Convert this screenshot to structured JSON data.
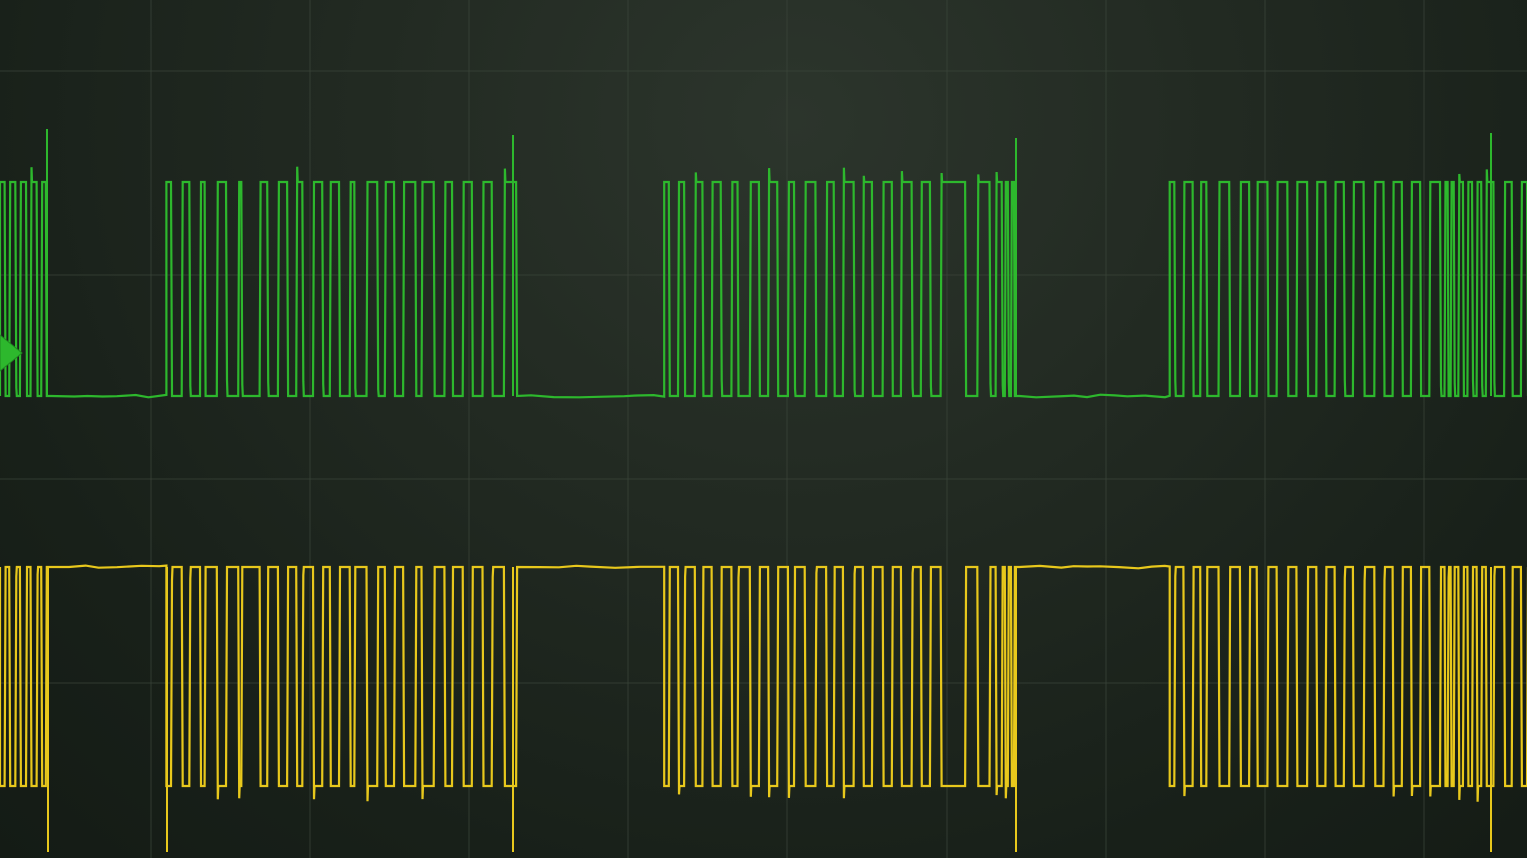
{
  "display": {
    "background": "#1e261e",
    "grid_color": "#3a4439",
    "grid": true,
    "horizontal_divisions": 10,
    "vertical_divisions": 4
  },
  "channels": [
    {
      "name": "",
      "color": "#2db82d",
      "level_marker_icon": "trigger-level-arrow-icon",
      "idle_level": "low",
      "packets": [
        {
          "start": 0.0,
          "end": 0.033,
          "transitions": [
            0.003,
            0.006,
            0.01,
            0.013,
            0.017,
            0.02,
            0.024,
            0.027,
            0.03
          ]
        },
        {
          "start": 0.109,
          "end": 0.338,
          "transitions": [
            0.112,
            0.119,
            0.124,
            0.131,
            0.134,
            0.142,
            0.148,
            0.156,
            0.158,
            0.17,
            0.175,
            0.182,
            0.188,
            0.194,
            0.198,
            0.205,
            0.211,
            0.216,
            0.222,
            0.229,
            0.232,
            0.24,
            0.247,
            0.252,
            0.258,
            0.264,
            0.272,
            0.276,
            0.284,
            0.291,
            0.296,
            0.303,
            0.309,
            0.316,
            0.322,
            0.33
          ]
        },
        {
          "start": 0.435,
          "end": 0.667,
          "transitions": [
            0.438,
            0.444,
            0.448,
            0.455,
            0.46,
            0.466,
            0.472,
            0.479,
            0.483,
            0.491,
            0.497,
            0.503,
            0.509,
            0.516,
            0.52,
            0.527,
            0.534,
            0.541,
            0.546,
            0.552,
            0.559,
            0.565,
            0.571,
            0.578,
            0.584,
            0.59,
            0.597,
            0.603,
            0.609,
            0.616,
            0.632,
            0.64,
            0.648,
            0.652,
            0.656,
            0.658,
            0.66,
            0.662,
            0.664
          ]
        },
        {
          "start": 0.766,
          "end": 1.0,
          "transitions": [
            0.769,
            0.775,
            0.781,
            0.786,
            0.79,
            0.798,
            0.805,
            0.812,
            0.818,
            0.823,
            0.83,
            0.836,
            0.843,
            0.849,
            0.856,
            0.862,
            0.868,
            0.874,
            0.88,
            0.886,
            0.893,
            0.9,
            0.906,
            0.912,
            0.918,
            0.924,
            0.93,
            0.936,
            0.943,
            0.946,
            0.948,
            0.95,
            0.952,
            0.955,
            0.958,
            0.961,
            0.964,
            0.967,
            0.97,
            0.973,
            0.978,
            0.985,
            0.99,
            0.996
          ]
        }
      ]
    },
    {
      "name": "",
      "color": "#e8c81c",
      "level_marker_icon": "",
      "idle_level": "high",
      "packets": [
        {
          "start": 0.0,
          "end": 0.033,
          "transitions": [
            0.003,
            0.006,
            0.01,
            0.013,
            0.017,
            0.02,
            0.024,
            0.027,
            0.03
          ]
        },
        {
          "start": 0.109,
          "end": 0.338,
          "transitions": [
            0.112,
            0.119,
            0.124,
            0.131,
            0.134,
            0.142,
            0.148,
            0.156,
            0.158,
            0.17,
            0.175,
            0.182,
            0.188,
            0.194,
            0.198,
            0.205,
            0.211,
            0.216,
            0.222,
            0.229,
            0.232,
            0.24,
            0.247,
            0.252,
            0.258,
            0.264,
            0.272,
            0.276,
            0.284,
            0.291,
            0.296,
            0.303,
            0.309,
            0.316,
            0.322,
            0.33
          ]
        },
        {
          "start": 0.435,
          "end": 0.667,
          "transitions": [
            0.438,
            0.444,
            0.448,
            0.455,
            0.46,
            0.466,
            0.472,
            0.479,
            0.483,
            0.491,
            0.497,
            0.503,
            0.509,
            0.516,
            0.52,
            0.527,
            0.534,
            0.541,
            0.546,
            0.552,
            0.559,
            0.565,
            0.571,
            0.578,
            0.584,
            0.59,
            0.597,
            0.603,
            0.609,
            0.616,
            0.632,
            0.64,
            0.648,
            0.652,
            0.656,
            0.658,
            0.66,
            0.662,
            0.664
          ]
        },
        {
          "start": 0.766,
          "end": 1.0,
          "transitions": [
            0.769,
            0.775,
            0.781,
            0.786,
            0.79,
            0.798,
            0.805,
            0.812,
            0.818,
            0.823,
            0.83,
            0.836,
            0.843,
            0.849,
            0.856,
            0.862,
            0.868,
            0.874,
            0.88,
            0.886,
            0.893,
            0.9,
            0.906,
            0.912,
            0.918,
            0.924,
            0.93,
            0.936,
            0.943,
            0.946,
            0.948,
            0.95,
            0.952,
            0.955,
            0.958,
            0.961,
            0.964,
            0.967,
            0.97,
            0.973,
            0.978,
            0.985,
            0.99,
            0.996
          ]
        }
      ]
    }
  ]
}
